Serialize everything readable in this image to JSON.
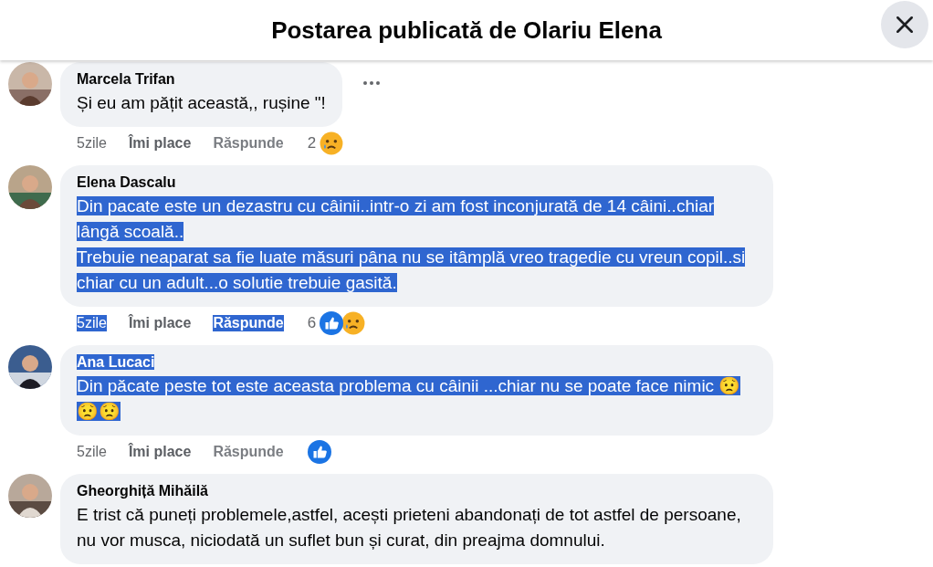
{
  "header": {
    "title": "Postarea publicată de Olariu Elena"
  },
  "comments": [
    {
      "author": {
        "text": "Marcela Trifan",
        "highlighted": false
      },
      "paragraphs": [
        {
          "text": "Și eu am pățit această,, rușine \"!",
          "highlighted": false
        }
      ],
      "more_menu": true,
      "actions": [
        {
          "label": "5zile",
          "kind": "time",
          "highlighted": false
        },
        {
          "label": "Îmi place",
          "kind": "like",
          "highlighted": false
        },
        {
          "label": "Răspunde",
          "kind": "reply",
          "highlighted": false
        }
      ],
      "reactions": {
        "count": "2",
        "types": [
          {
            "kind": "sad"
          }
        ]
      }
    },
    {
      "author": {
        "text": "Elena Dascalu",
        "highlighted": false
      },
      "paragraphs": [
        {
          "text": "Din pacate este un dezastru cu câinii..intr-o zi am fost inconjurată de 14 câini..chiar lângă scoală..",
          "highlighted": true
        },
        {
          "text": "Trebuie neaparat sa fie luate măsuri pâna nu se itâmplă vreo tragedie cu vreun copil..si chiar cu un adult...o solutie trebuie gasită.",
          "highlighted": true
        }
      ],
      "more_menu": false,
      "actions": [
        {
          "label": "5zile",
          "kind": "time",
          "highlighted": true
        },
        {
          "label": "Îmi place",
          "kind": "like",
          "highlighted": false
        },
        {
          "label": "Răspunde",
          "kind": "reply",
          "highlighted": true
        }
      ],
      "reactions": {
        "count": "6",
        "types": [
          {
            "kind": "like"
          },
          {
            "kind": "sad"
          }
        ]
      }
    },
    {
      "author": {
        "text": "Ana Lucaci",
        "highlighted": true
      },
      "paragraphs": [
        {
          "text": "Din păcate peste tot este aceasta problema cu câinii ...chiar nu se poate face nimic 😟😟😟",
          "highlighted": true
        }
      ],
      "more_menu": false,
      "actions": [
        {
          "label": "5zile",
          "kind": "time",
          "highlighted": false
        },
        {
          "label": "Îmi place",
          "kind": "like",
          "highlighted": false
        },
        {
          "label": "Răspunde",
          "kind": "reply",
          "highlighted": false
        }
      ],
      "reactions": {
        "types": [
          {
            "kind": "like"
          }
        ]
      }
    },
    {
      "author": {
        "text": "Gheorghiță Mihăilă",
        "highlighted": false
      },
      "paragraphs": [
        {
          "text": "E trist că puneți problemele,astfel, acești prieteni abandonați de tot astfel de persoane, nu vor musca, niciodată un suflet bun și curat, din preajma domnului.",
          "highlighted": false
        }
      ],
      "more_menu": false
    }
  ]
}
